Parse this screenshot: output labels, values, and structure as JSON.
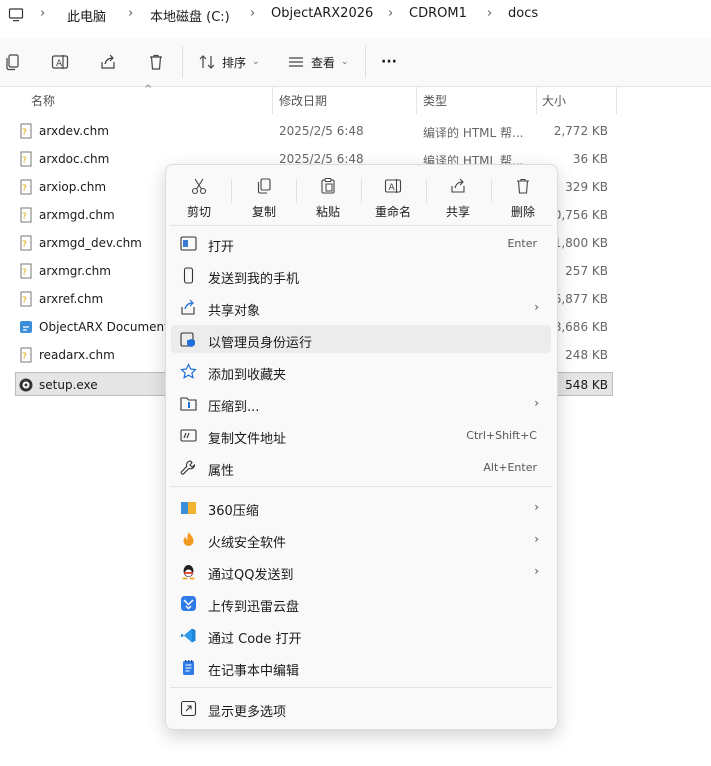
{
  "breadcrumb": [
    "此电脑",
    "本地磁盘 (C:)",
    "ObjectARX2026",
    "CDROM1",
    "docs"
  ],
  "toolbar": {
    "sort_label": "排序",
    "view_label": "查看",
    "more_label": "···"
  },
  "columns": {
    "name": "名称",
    "date": "修改日期",
    "type": "类型",
    "size": "大小"
  },
  "files": [
    {
      "name": "arxdev.chm",
      "date": "2025/2/5 6:48",
      "type": "编译的 HTML 帮...",
      "size": "2,772 KB"
    },
    {
      "name": "arxdoc.chm",
      "date": "2025/2/5 6:48",
      "type": "编译的 HTML 帮...",
      "size": "36 KB"
    },
    {
      "name": "arxiop.chm",
      "date": "",
      "type": "",
      "size": "329 KB"
    },
    {
      "name": "arxmgd.chm",
      "date": "",
      "type": "",
      "size": "0,756 KB"
    },
    {
      "name": "arxmgd_dev.chm",
      "date": "",
      "type": "",
      "size": "1,800 KB"
    },
    {
      "name": "arxmgr.chm",
      "date": "",
      "type": "",
      "size": "257 KB"
    },
    {
      "name": "arxref.chm",
      "date": "",
      "type": "",
      "size": "6,877 KB"
    },
    {
      "name": "ObjectARX Document",
      "date": "",
      "type": "",
      "size": "8,686 KB"
    },
    {
      "name": "readarx.chm",
      "date": "",
      "type": "",
      "size": "248 KB"
    },
    {
      "name": "setup.exe",
      "date": "",
      "type": "",
      "size": "548 KB"
    }
  ],
  "context_menu": {
    "quick_actions": [
      "剪切",
      "复制",
      "粘贴",
      "重命名",
      "共享",
      "删除"
    ],
    "group1": [
      {
        "label": "打开",
        "shortcut": "Enter",
        "icon": "open-icon"
      },
      {
        "label": "发送到我的手机",
        "shortcut": "",
        "icon": "phone-icon"
      },
      {
        "label": "共享对象",
        "shortcut": "",
        "icon": "share-icon",
        "submenu": true
      },
      {
        "label": "以管理员身份运行",
        "shortcut": "",
        "icon": "shield-icon"
      },
      {
        "label": "添加到收藏夹",
        "shortcut": "",
        "icon": "star-icon"
      },
      {
        "label": "压缩到...",
        "shortcut": "",
        "icon": "zip-icon",
        "submenu": true
      },
      {
        "label": "复制文件地址",
        "shortcut": "Ctrl+Shift+C",
        "icon": "path-icon"
      },
      {
        "label": "属性",
        "shortcut": "Alt+Enter",
        "icon": "wrench-icon"
      }
    ],
    "group2": [
      {
        "label": "360压缩",
        "icon": "360zip-icon",
        "submenu": true
      },
      {
        "label": "火绒安全软件",
        "icon": "huorong-icon",
        "submenu": true
      },
      {
        "label": "通过QQ发送到",
        "icon": "qq-icon",
        "submenu": true
      },
      {
        "label": "上传到迅雷云盘",
        "icon": "xunlei-icon",
        "submenu": false
      },
      {
        "label": "通过 Code 打开",
        "icon": "vscode-icon",
        "submenu": false
      },
      {
        "label": "在记事本中编辑",
        "icon": "notepad-icon",
        "submenu": false
      }
    ],
    "more_options": "显示更多选项"
  },
  "colors": {
    "selection": "#e5e5e5",
    "accent": "#0067c0"
  }
}
